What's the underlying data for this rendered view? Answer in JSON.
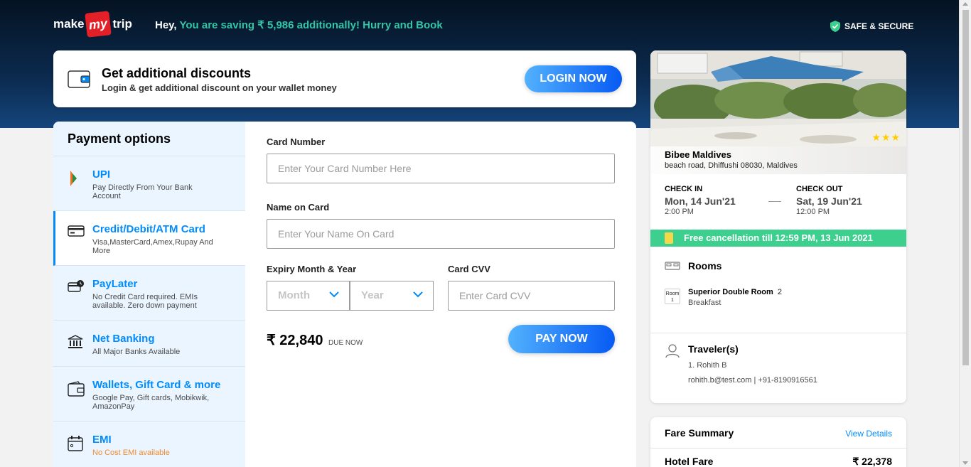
{
  "header": {
    "logo_left": "make",
    "logo_mid": "my",
    "logo_right": "trip",
    "greeting": "Hey,",
    "promo_text": "You are saving ₹ 5,986 additionally! Hurry and Book",
    "secure_label": "SAFE & SECURE"
  },
  "discount": {
    "title": "Get additional discounts",
    "subtitle": "Login & get additional discount on your wallet money",
    "login_label": "LOGIN NOW"
  },
  "payment_options": {
    "heading": "Payment options",
    "items": [
      {
        "label": "UPI",
        "desc": "Pay Directly From Your Bank Account",
        "icon": "bhim-upi-icon"
      },
      {
        "label": "Credit/Debit/ATM Card",
        "desc": "Visa,MasterCard,Amex,Rupay And More",
        "icon": "card-icon",
        "active": true
      },
      {
        "label": "PayLater",
        "desc": "No Credit Card required. EMIs available. Zero down payment",
        "icon": "paylater-icon"
      },
      {
        "label": "Net Banking",
        "desc": "All Major Banks Available",
        "icon": "bank-icon"
      },
      {
        "label": "Wallets, Gift Card & more",
        "desc": "Google Pay, Gift cards, Mobikwik, AmazonPay",
        "icon": "wallet-icon"
      },
      {
        "label": "EMI",
        "desc": "No Cost EMI available",
        "icon": "emi-calendar-icon"
      }
    ]
  },
  "card_form": {
    "card_number_label": "Card Number",
    "card_number_placeholder": "Enter Your Card Number Here",
    "name_label": "Name on Card",
    "name_placeholder": "Enter Your Name On Card",
    "expiry_label": "Expiry Month & Year",
    "month_placeholder": "Month",
    "year_placeholder": "Year",
    "cvv_label": "Card CVV",
    "cvv_placeholder": "Enter Card CVV",
    "amount": "₹ 22,840",
    "due_label": "DUE NOW",
    "pay_label": "PAY NOW"
  },
  "hotel": {
    "name": "Bibee Maldives",
    "address": "beach road, Dhiffushi 08030, Maldives",
    "star_rating": 3,
    "stars": "★★★",
    "checkin_label": "CHECK IN",
    "checkin_date": "Mon, 14 Jun'21",
    "checkin_time": "2:00 PM",
    "checkout_label": "CHECK OUT",
    "checkout_date": "Sat, 19 Jun'21",
    "checkout_time": "12:00 PM",
    "free_cancellation": "Free cancellation till 12:59 PM, 13 Jun 2021",
    "rooms_heading": "Rooms",
    "room_badge_top": "Room",
    "room_badge_num": "1",
    "room_name": "Superior Double Room",
    "room_count": "2",
    "room_meal": "Breakfast",
    "travelers_heading": "Traveler(s)",
    "traveler_name": "1. Rohith B",
    "traveler_contact": "rohith.b@test.com | +91-8190916561"
  },
  "fare": {
    "heading": "Fare Summary",
    "details_link": "View Details",
    "row_label": "Hotel Fare",
    "row_value": "₹ 22,378"
  },
  "colors": {
    "accent_blue": "#008cff",
    "promo_green": "#34c4a6",
    "cancel_green": "#3ccf8e",
    "brand_red": "#e32028"
  }
}
